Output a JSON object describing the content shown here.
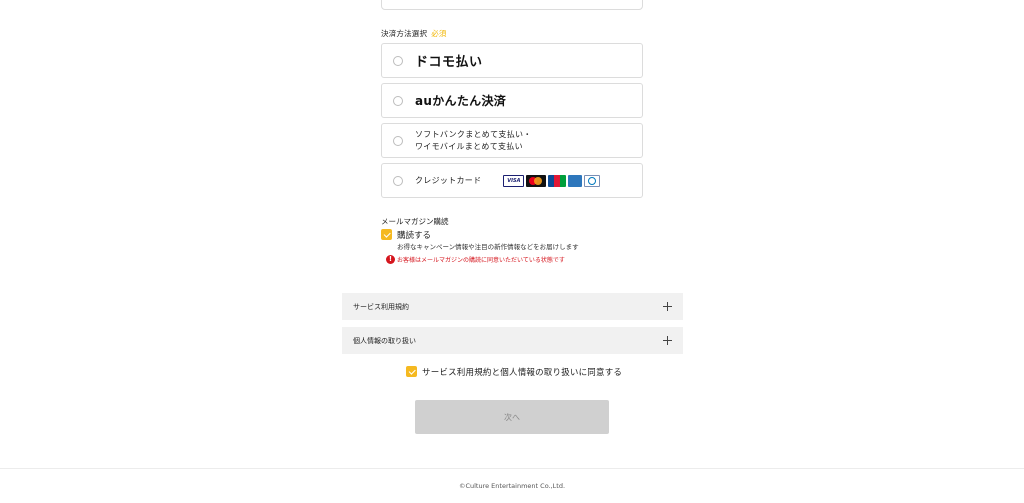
{
  "payment": {
    "section_label": "決済方法選択",
    "required_badge": "必須",
    "options": [
      {
        "label": "ドコモ払い"
      },
      {
        "label": "auかんたん決済"
      },
      {
        "label_line1": "ソフトバンクまとめて支払い・",
        "label_line2": "ワイモバイルまとめて支払い"
      },
      {
        "label": "クレジットカード",
        "card_brands": [
          "VISA",
          "Mastercard",
          "JCB",
          "AMEX",
          "Diners Club"
        ]
      }
    ]
  },
  "magazine": {
    "section_label": "メールマガジン購読",
    "checkbox_label": "購読する",
    "checked": true,
    "description": "お得なキャンペーン情報や注目の新作情報などをお届けします",
    "notice": "お客様はメールマガジンの購読に同意いただいている状態です"
  },
  "accordions": [
    {
      "title": "サービス利用規約"
    },
    {
      "title": "個人情報の取り扱い"
    }
  ],
  "agreement": {
    "label": "サービス利用規約と個人情報の取り扱いに同意する",
    "checked": true
  },
  "next_button": {
    "label": "次へ"
  },
  "footer": {
    "copyright": "©Culture Entertainment Co.,Ltd."
  },
  "colors": {
    "accent": "#f5b920",
    "warning": "#d5161e",
    "disabled_button": "#d0d0d0"
  },
  "icons": [
    "radio-icon",
    "checkbox-icon",
    "warning-icon",
    "plus-icon"
  ]
}
